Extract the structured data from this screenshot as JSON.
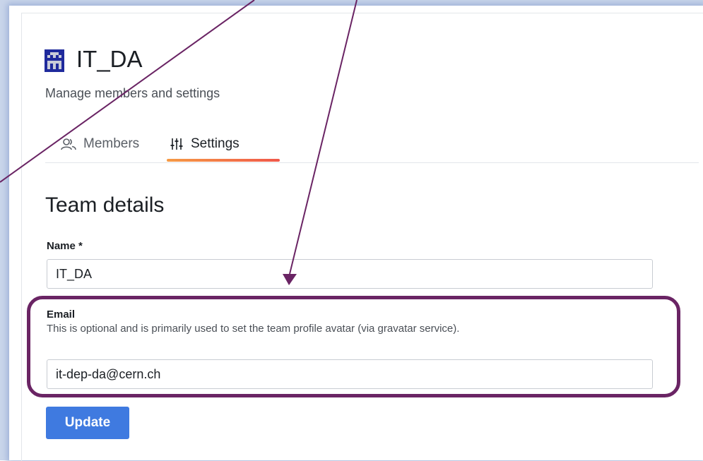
{
  "team": {
    "name": "IT_DA",
    "subtitle": "Manage members and settings"
  },
  "tabs": [
    {
      "label": "Members",
      "icon": "users-icon",
      "active": false
    },
    {
      "label": "Settings",
      "icon": "sliders-icon",
      "active": true
    }
  ],
  "section": {
    "title": "Team details"
  },
  "form": {
    "name_label": "Name *",
    "name_value": "IT_DA",
    "email_label": "Email",
    "email_help": "This is optional and is primarily used to set the team profile avatar (via gravatar service).",
    "email_value": "it-dep-da@cern.ch",
    "update_label": "Update"
  },
  "colors": {
    "accent": "#3f7ae0",
    "tab_underline_start": "#f59a45",
    "tab_underline_end": "#f0584a",
    "annotation": "#6a2464"
  }
}
